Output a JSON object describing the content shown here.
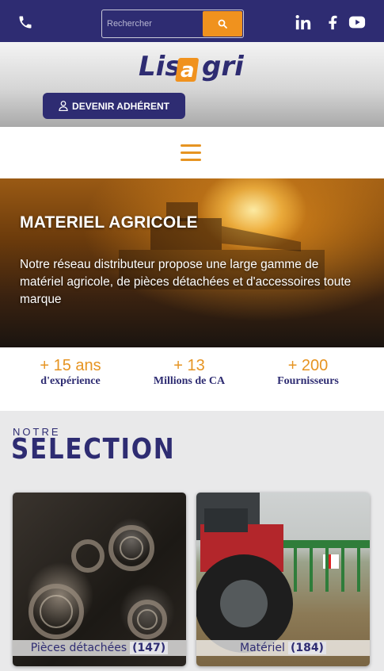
{
  "topbar": {
    "search_placeholder": "Rechercher",
    "icons": [
      "phone-icon",
      "search-icon",
      "linkedin-icon",
      "facebook-icon",
      "youtube-icon"
    ]
  },
  "header": {
    "logo_text": "LisAgri",
    "join_button": "DEVENIR ADHÉRENT"
  },
  "hero": {
    "title": "MATERIEL AGRICOLE",
    "text": "Notre réseau distributeur propose une large gamme de matériel agricole, de pièces détachées et d'accessoires toute marque"
  },
  "stats": [
    {
      "number": "+ 15 ans",
      "label": "d'expérience"
    },
    {
      "number": "+ 13",
      "label": "Millions de CA"
    },
    {
      "number": "+ 200",
      "label": "Fournisseurs"
    }
  ],
  "selection": {
    "kicker": "NOTRE",
    "title": "SELECTION",
    "cards": [
      {
        "label": "Pièces détachées",
        "count": "(147)"
      },
      {
        "label": "Matériel",
        "count": "(184)"
      }
    ]
  },
  "colors": {
    "brand_navy": "#2e2c72",
    "accent_orange": "#f0921e"
  }
}
